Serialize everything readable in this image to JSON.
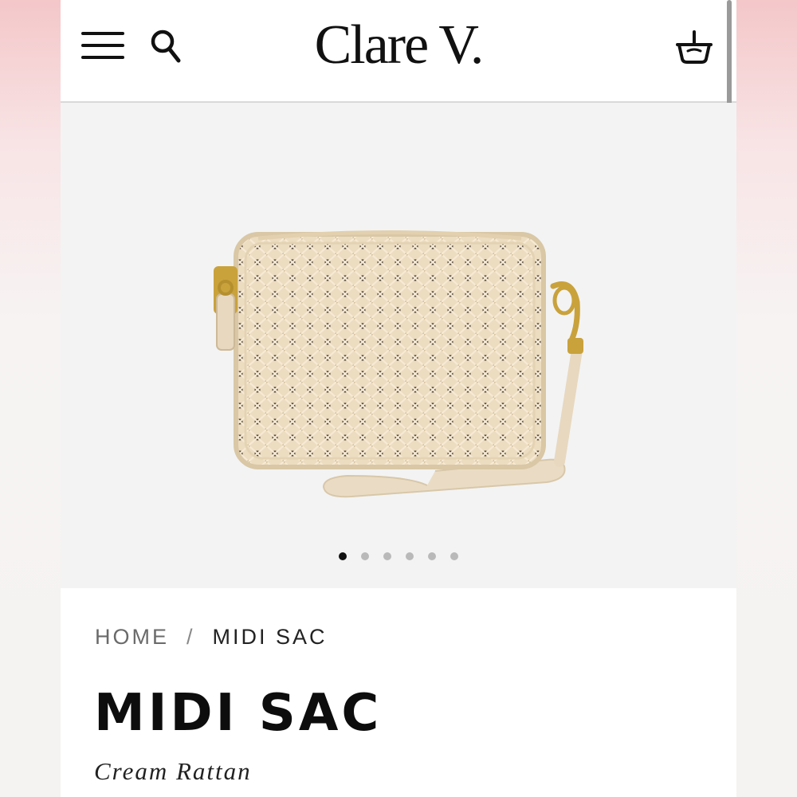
{
  "header": {
    "brand": "Clare V.",
    "icons": {
      "menu": "menu-icon",
      "search": "search-icon",
      "cart": "basket-icon"
    }
  },
  "gallery": {
    "image_alt": "cream-rattan-crossbody-bag",
    "slide_count": 6,
    "active_slide": 1
  },
  "breadcrumb": {
    "home": "HOME",
    "separator": "/",
    "current": "MIDI SAC"
  },
  "product": {
    "title": "MIDI SAC",
    "color": "Cream Rattan"
  },
  "colors": {
    "bag": "#ecdcc0",
    "hardware": "#c9a23c",
    "text": "#0d0d0d"
  }
}
